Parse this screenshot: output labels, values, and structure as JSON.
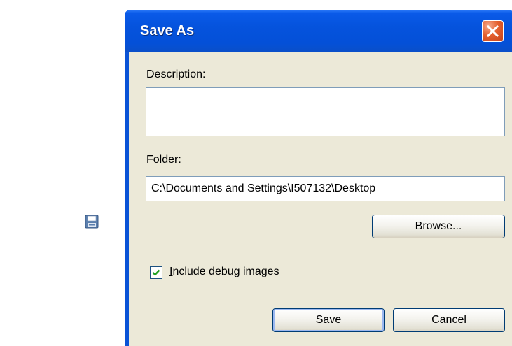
{
  "dialog": {
    "title": "Save As",
    "description_label": "Description:",
    "description_value": "",
    "folder_label_accel": "F",
    "folder_label_rest": "older:",
    "folder_value": "C:\\Documents and Settings\\I507132\\Desktop",
    "browse_label": "Browse...",
    "include_debug": {
      "checked": true,
      "label_accel": "I",
      "label_rest": "nclude debug images"
    },
    "save_label_pre": "Sa",
    "save_label_accel": "v",
    "save_label_post": "e",
    "cancel_label": "Cancel"
  },
  "icons": {
    "side_icon": "save-icon",
    "close": "close-icon",
    "check": "checkmark-icon"
  },
  "colors": {
    "titlebar": "#0553dd",
    "client_bg": "#ece9d8",
    "close_btn": "#e4602f",
    "checkmark": "#21a121"
  }
}
